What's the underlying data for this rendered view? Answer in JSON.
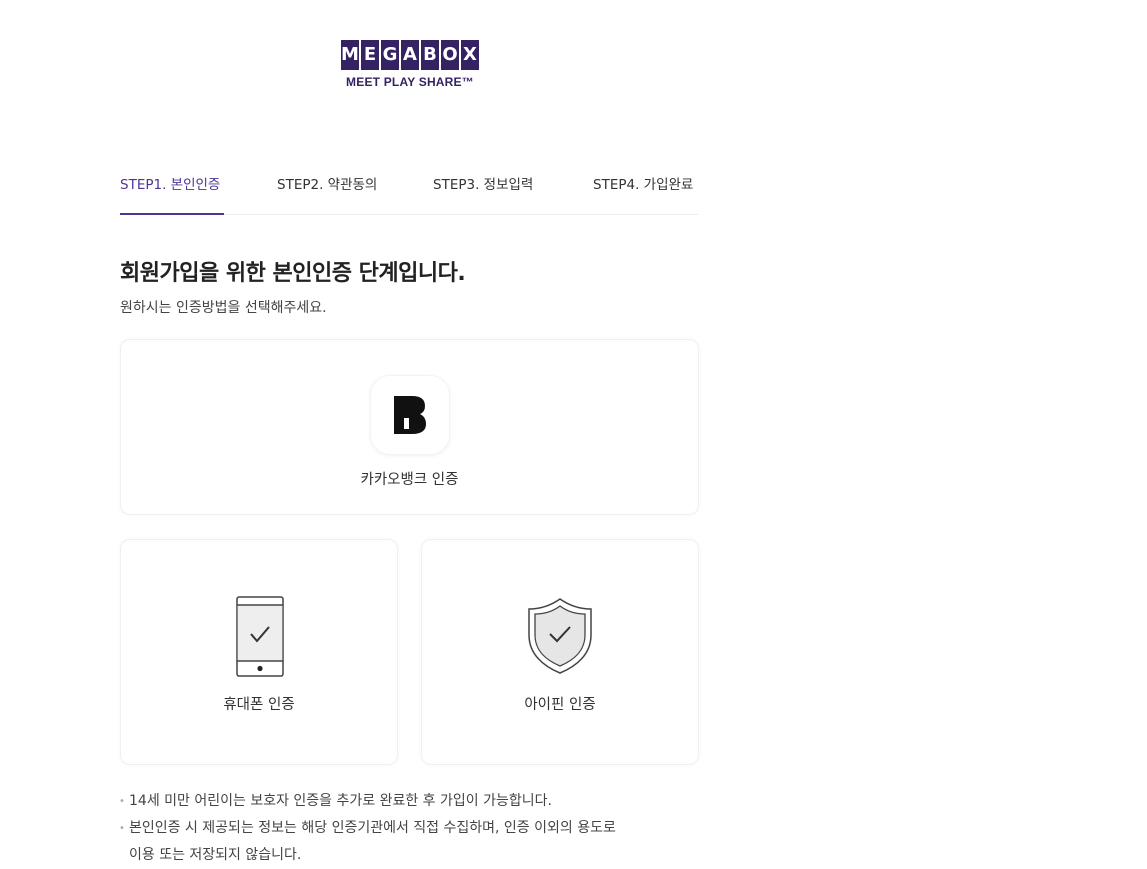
{
  "logo": {
    "letters": [
      "M",
      "E",
      "G",
      "A",
      "B",
      "O",
      "X"
    ],
    "tagline": "MEET PLAY SHARE™"
  },
  "steps": [
    {
      "label": "STEP1. 본인인증",
      "active": true
    },
    {
      "label": "STEP2. 약관동의",
      "active": false
    },
    {
      "label": "STEP3. 정보입력",
      "active": false
    },
    {
      "label": "STEP4. 가입완료",
      "active": false
    }
  ],
  "heading": "회원가입을 위한 본인인증 단계입니다.",
  "subheading": "원하시는 인증방법을 선택해주세요.",
  "methods": {
    "kakaobank": {
      "label": "카카오뱅크 인증",
      "icon": "kakaobank-icon"
    },
    "phone": {
      "label": "휴대폰 인증",
      "icon": "mobile-phone-icon"
    },
    "ipin": {
      "label": "아이핀 인증",
      "icon": "shield-check-icon"
    }
  },
  "notices": [
    {
      "line1": "14세 미만 어린이는 보호자 인증을 추가로 완료한 후 가입이 가능합니다.",
      "line2": ""
    },
    {
      "line1": "본인인증 시 제공되는 정보는 해당 인증기관에서 직접 수집하며, 인증 이외의 용도로",
      "line2": "이용 또는 저장되지 않습니다."
    }
  ],
  "colors": {
    "brand": "#352263",
    "active_step": "#503396",
    "text": "#222222"
  }
}
